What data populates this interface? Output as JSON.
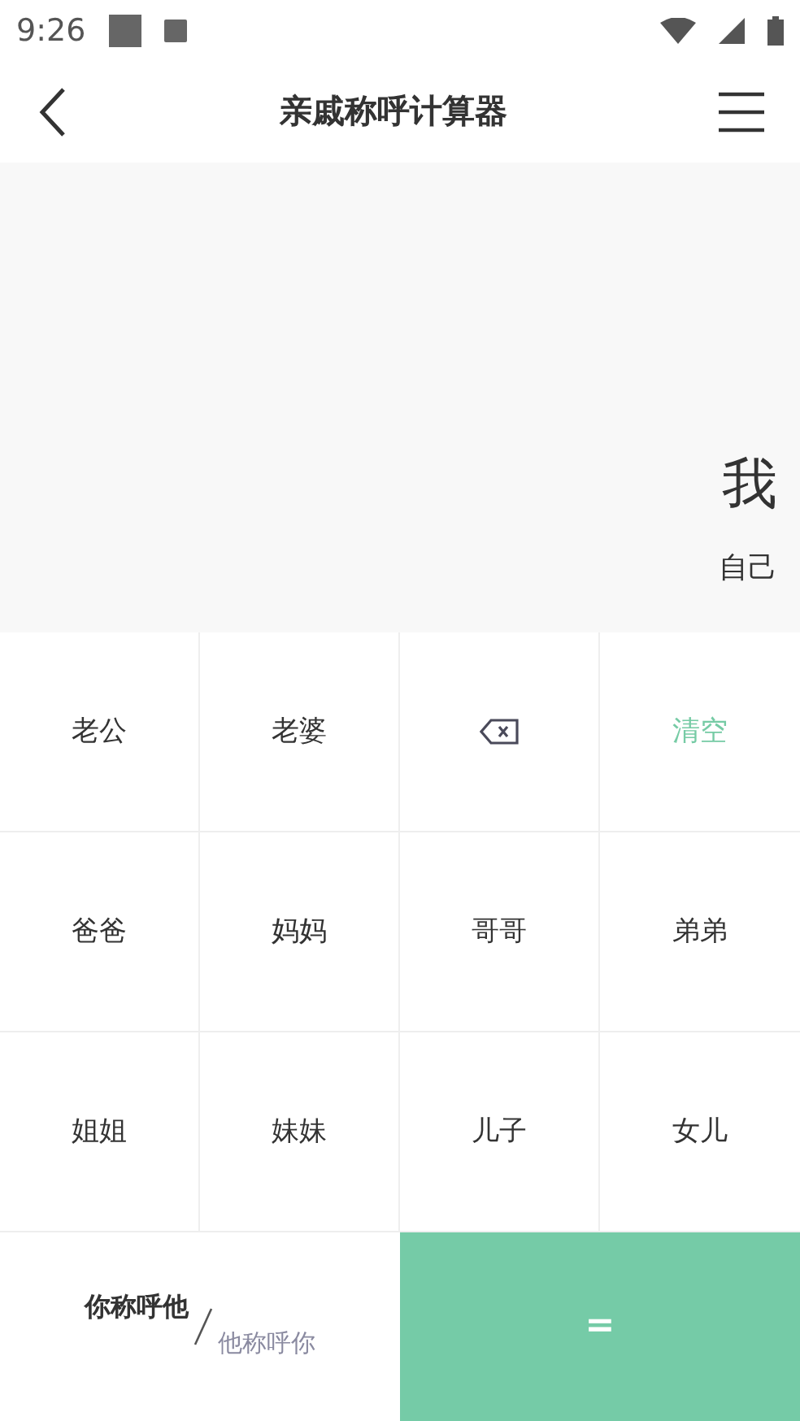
{
  "status_bar": {
    "time": "9:26"
  },
  "header": {
    "title": "亲戚称呼计算器"
  },
  "display": {
    "result": "我",
    "expression": "自己"
  },
  "keys": [
    {
      "kind": "text",
      "label": "老公"
    },
    {
      "kind": "text",
      "label": "老婆"
    },
    {
      "kind": "backspace"
    },
    {
      "kind": "clear",
      "label": "清空"
    },
    {
      "kind": "text",
      "label": "爸爸"
    },
    {
      "kind": "text",
      "label": "妈妈"
    },
    {
      "kind": "text",
      "label": "哥哥"
    },
    {
      "kind": "text",
      "label": "弟弟"
    },
    {
      "kind": "text",
      "label": "姐姐"
    },
    {
      "kind": "text",
      "label": "妹妹"
    },
    {
      "kind": "text",
      "label": "儿子"
    },
    {
      "kind": "text",
      "label": "女儿"
    }
  ],
  "mode_toggle": [
    {
      "label": "你称呼他",
      "selected": true
    },
    {
      "label": "他称呼你",
      "selected": false
    }
  ],
  "equals_button": {
    "label": "="
  }
}
